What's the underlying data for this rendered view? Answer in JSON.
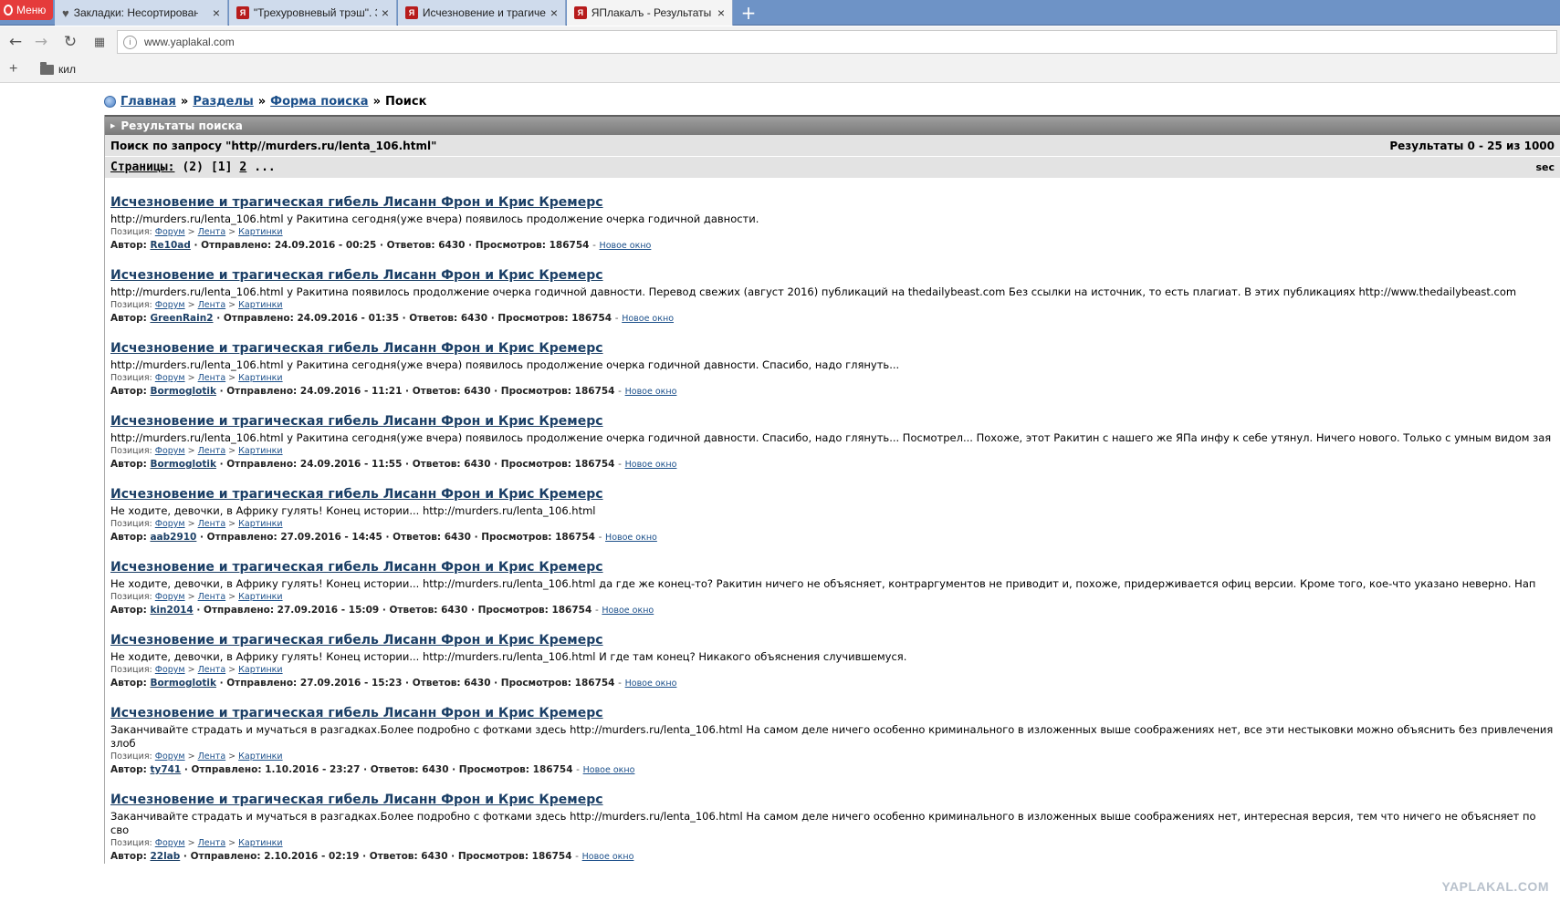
{
  "browser": {
    "menu_label": "Меню",
    "tabs": [
      {
        "label": "Закладки: Несортирован",
        "icon": "heart-icon",
        "active": false
      },
      {
        "label": "\"Трехуровневый трэш\". З",
        "icon": "yaplakal-icon",
        "active": false
      },
      {
        "label": "Исчезновение и трагичес",
        "icon": "yaplakal-icon",
        "active": false
      },
      {
        "label": "ЯПлакалъ - Результаты п",
        "icon": "yaplakal-icon",
        "active": true
      }
    ],
    "url": "www.yaplakal.com",
    "bookmark_folder": "кил"
  },
  "breadcrumb": {
    "home": "Главная",
    "sep": "»",
    "sections": "Разделы",
    "search_form": "Форма поиска",
    "current": "Поиск"
  },
  "panel": {
    "title": "Результаты поиска",
    "query_text": "Поиск по запросу \"http//murders.ru/lenta_106.html\"",
    "results_count": "Результаты 0 - 25 из 1000",
    "pages_label": "Страницы:",
    "pages_total": "(2)",
    "page_current": "[1]",
    "page_next": "2",
    "page_more": "...",
    "sec_label": "sec"
  },
  "results": [
    {
      "title": "Исчезновение и трагическая гибель Лисанн Фрон и Крис Кремерс",
      "snippet": "http://murders.ru/lenta_106.html у Ракитина сегодня(уже вчера) появилось продолжение очерка годичной давности.",
      "path_label": "Позиция:",
      "path": [
        "Форум",
        "Лента",
        "Картинки"
      ],
      "author_label": "Автор:",
      "author": "Re10ad",
      "sent": "· Отправлено: 24.09.2016 - 00:25 · Ответов: 6430 · Просмотров: 186754",
      "new_window": "Новое окно"
    },
    {
      "title": "Исчезновение и трагическая гибель Лисанн Фрон и Крис Кремерс",
      "snippet": "http://murders.ru/lenta_106.html у Ракитина  появилось продолжение очерка годичной давности. Перевод свежих (август 2016) публикаций на thedailybeast.com Без ссылки на источник, то есть плагиат. В этих публикациях http://www.thedailybeast.com",
      "path_label": "Позиция:",
      "path": [
        "Форум",
        "Лента",
        "Картинки"
      ],
      "author_label": "Автор:",
      "author": "GreenRain2",
      "sent": "· Отправлено: 24.09.2016 - 01:35 · Ответов: 6430 · Просмотров: 186754",
      "new_window": "Новое окно"
    },
    {
      "title": "Исчезновение и трагическая гибель Лисанн Фрон и Крис Кремерс",
      "snippet": "http://murders.ru/lenta_106.html у Ракитина сегодня(уже вчера) появилось продолжение очерка годичной давности. Спасибо, надо глянуть...",
      "path_label": "Позиция:",
      "path": [
        "Форум",
        "Лента",
        "Картинки"
      ],
      "author_label": "Автор:",
      "author": "Bormoglotik",
      "sent": "· Отправлено: 24.09.2016 - 11:21 · Ответов: 6430 · Просмотров: 186754",
      "new_window": "Новое окно"
    },
    {
      "title": "Исчезновение и трагическая гибель Лисанн Фрон и Крис Кремерс",
      "snippet": "http://murders.ru/lenta_106.html у Ракитина сегодня(уже вчера) появилось продолжение очерка годичной давности. Спасибо, надо глянуть... Посмотрел... Похоже, этот Ракитин с нашего же ЯПа инфу к себе утянул. Ничего нового. Только с умным видом зая",
      "path_label": "Позиция:",
      "path": [
        "Форум",
        "Лента",
        "Картинки"
      ],
      "author_label": "Автор:",
      "author": "Bormoglotik",
      "sent": "· Отправлено: 24.09.2016 - 11:55 · Ответов: 6430 · Просмотров: 186754",
      "new_window": "Новое окно"
    },
    {
      "title": "Исчезновение и трагическая гибель Лисанн Фрон и Крис Кремерс",
      "snippet": "Не ходите, девочки, в Африку гулять! Конец истории... http://murders.ru/lenta_106.html",
      "path_label": "Позиция:",
      "path": [
        "Форум",
        "Лента",
        "Картинки"
      ],
      "author_label": "Автор:",
      "author": "aab2910",
      "sent": "· Отправлено: 27.09.2016 - 14:45 · Ответов: 6430 · Просмотров: 186754",
      "new_window": "Новое окно"
    },
    {
      "title": "Исчезновение и трагическая гибель Лисанн Фрон и Крис Кремерс",
      "snippet": "Не ходите, девочки, в Африку гулять! Конец истории... http://murders.ru/lenta_106.html да где же конец-то? Ракитин ничего не объясняет, контраргументов не приводит и, похоже, придерживается офиц версии. Кроме того, кое-что указано неверно. Нап",
      "path_label": "Позиция:",
      "path": [
        "Форум",
        "Лента",
        "Картинки"
      ],
      "author_label": "Автор:",
      "author": "kin2014",
      "sent": "· Отправлено: 27.09.2016 - 15:09 · Ответов: 6430 · Просмотров: 186754",
      "new_window": "Новое окно"
    },
    {
      "title": "Исчезновение и трагическая гибель Лисанн Фрон и Крис Кремерс",
      "snippet": "Не ходите, девочки, в Африку гулять! Конец истории... http://murders.ru/lenta_106.html И где там конец? Никакого объяснения случившемуся.",
      "path_label": "Позиция:",
      "path": [
        "Форум",
        "Лента",
        "Картинки"
      ],
      "author_label": "Автор:",
      "author": "Bormoglotik",
      "sent": "· Отправлено: 27.09.2016 - 15:23 · Ответов: 6430 · Просмотров: 186754",
      "new_window": "Новое окно"
    },
    {
      "title": "Исчезновение и трагическая гибель Лисанн Фрон и Крис Кремерс",
      "snippet": "Заканчивайте страдать и мучаться в разгадках.Более подробно с фотками здесь http://murders.ru/lenta_106.html На самом деле ничего особенно криминального в изложенных выше соображениях нет, все эти нестыковки можно объяснить без привлечения злоб",
      "path_label": "Позиция:",
      "path": [
        "Форум",
        "Лента",
        "Картинки"
      ],
      "author_label": "Автор:",
      "author": "ty741",
      "sent": "· Отправлено: 1.10.2016 - 23:27 · Ответов: 6430 · Просмотров: 186754",
      "new_window": "Новое окно"
    },
    {
      "title": "Исчезновение и трагическая гибель Лисанн Фрон и Крис Кремерс",
      "snippet": "Заканчивайте страдать и мучаться в разгадках.Более подробно с фотками здесь http://murders.ru/lenta_106.html      На самом деле ничего особенно криминального в изложенных выше соображениях нет, интересная версия, тем что ничего не объясняет по сво",
      "path_label": "Позиция:",
      "path": [
        "Форум",
        "Лента",
        "Картинки"
      ],
      "author_label": "Автор:",
      "author": "22lab",
      "sent": "· Отправлено: 2.10.2016 - 02:19 · Ответов: 6430 · Просмотров: 186754",
      "new_window": "Новое окно"
    }
  ],
  "watermark": "YAPLAKAL.COM"
}
